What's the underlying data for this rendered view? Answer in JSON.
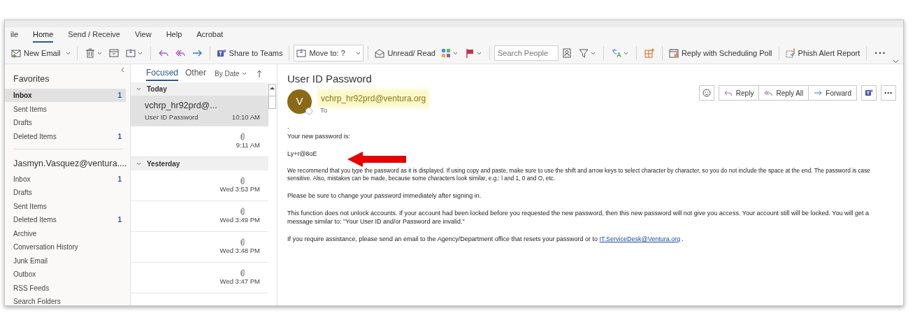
{
  "ribbon_tabs": [
    {
      "label": "ile",
      "selected": false
    },
    {
      "label": "Home",
      "selected": true
    },
    {
      "label": "Send / Receive",
      "selected": false
    },
    {
      "label": "View",
      "selected": false
    },
    {
      "label": "Help",
      "selected": false
    },
    {
      "label": "Acrobat",
      "selected": false
    }
  ],
  "toolbar": [
    {
      "kind": "button",
      "label": "New Email",
      "caret": true
    },
    {
      "kind": "divider"
    },
    {
      "kind": "icon",
      "caret": true
    },
    {
      "kind": "icon",
      "caret": false
    },
    {
      "kind": "icon",
      "caret": true
    },
    {
      "kind": "divider"
    },
    {
      "kind": "icon",
      "caret": false
    },
    {
      "kind": "icon",
      "caret": false
    },
    {
      "kind": "icon",
      "caret": false
    },
    {
      "kind": "divider"
    },
    {
      "kind": "button",
      "label": "Share to Teams",
      "caret": false
    },
    {
      "kind": "divider"
    },
    {
      "kind": "dropdown",
      "label": "Move to: ?"
    },
    {
      "kind": "divider"
    },
    {
      "kind": "button",
      "label": "Unread/ Read",
      "caret": false
    },
    {
      "kind": "icon",
      "caret": true
    },
    {
      "kind": "icon",
      "caret": true
    },
    {
      "kind": "divider"
    },
    {
      "kind": "search",
      "placeholder": "Search People"
    },
    {
      "kind": "icon",
      "caret": false
    },
    {
      "kind": "icon",
      "caret": true
    },
    {
      "kind": "divider"
    },
    {
      "kind": "icon",
      "caret": true
    },
    {
      "kind": "divider"
    },
    {
      "kind": "icon",
      "caret": false
    },
    {
      "kind": "divider"
    },
    {
      "kind": "button",
      "label": "Reply with Scheduling Poll",
      "caret": false
    },
    {
      "kind": "divider"
    },
    {
      "kind": "button",
      "label": "Phish Alert Report",
      "caret": false
    },
    {
      "kind": "divider"
    },
    {
      "kind": "more",
      "label": "···"
    }
  ],
  "folder_pane": {
    "sections": [
      {
        "title": "Favorites",
        "items": [
          {
            "name": "Inbox",
            "count": "1",
            "selected": true
          },
          {
            "name": "Sent Items",
            "selected": false
          },
          {
            "name": "Drafts",
            "selected": false
          },
          {
            "name": "Deleted Items",
            "count": "1",
            "selected": false
          }
        ]
      },
      {
        "title": "Jasmyn.Vasquez@ventura....",
        "items": [
          {
            "name": "Inbox",
            "count": "1",
            "selected": false
          },
          {
            "name": "Drafts",
            "selected": false
          },
          {
            "name": "Sent Items",
            "selected": false
          },
          {
            "name": "Deleted Items",
            "count": "1",
            "selected": false
          },
          {
            "name": "Archive",
            "selected": false
          },
          {
            "name": "Conversation History",
            "selected": false
          },
          {
            "name": "Junk Email",
            "selected": false
          },
          {
            "name": "Outbox",
            "selected": false
          },
          {
            "name": "RSS Feeds",
            "selected": false
          },
          {
            "name": "Search Folders",
            "selected": false
          }
        ]
      }
    ]
  },
  "message_list": {
    "tabs": [
      {
        "label": "Focused",
        "selected": true
      },
      {
        "label": "Other",
        "selected": false
      }
    ],
    "sort": "By Date",
    "groups": [
      {
        "label": "Today",
        "expanded": true,
        "messages": [
          {
            "sender": "vchrp_hr92prd@...",
            "subject": "User ID Password",
            "time": "10:10 AM",
            "attachment": false,
            "selected": true
          },
          {
            "time": "9:11 AM",
            "attachment": true,
            "selected": false
          }
        ]
      },
      {
        "label": "Yesterday",
        "expanded": true,
        "messages": [
          {
            "time": "Wed 3:53 PM",
            "attachment": true,
            "selected": false
          },
          {
            "time": "Wed 3:49 PM",
            "attachment": true,
            "selected": false
          },
          {
            "time": "Wed 3:48 PM",
            "attachment": true,
            "selected": false
          },
          {
            "time": "Wed 3:47 PM",
            "attachment": true,
            "selected": false
          }
        ]
      }
    ]
  },
  "reading_pane": {
    "subject": "User ID Password",
    "avatar": {
      "initial": "V",
      "color": "#8a6a17"
    },
    "from": "vchrp_hr92prd@ventura.org",
    "to_label": "To",
    "actions": [
      {
        "kind": "icon"
      },
      {
        "kind": "button",
        "label": "Reply"
      },
      {
        "kind": "button",
        "label": "Reply All"
      },
      {
        "kind": "button",
        "label": "Forward"
      },
      {
        "kind": "icon"
      },
      {
        "kind": "more",
        "label": "···"
      }
    ],
    "body": [
      {
        "kind": "plain",
        "text": "."
      },
      {
        "kind": "plain",
        "text": "Your new password is:"
      },
      {
        "kind": "password",
        "text": "Ly+r@8oE"
      },
      {
        "kind": "small",
        "text": "We recommend that you type the password as it is displayed.  If using copy and paste, make sure to use the shift and arrow keys to select character by character, so you do not include the space at the end.  The password is case sensitive.  Also, mistakes can be made, because some characters look similar, e.g.:  l  and  1,  0  and  O, etc."
      },
      {
        "kind": "plain",
        "text": "Please be sure to change your password immediately after signing in."
      },
      {
        "kind": "plain",
        "text": "This function does not unlock accounts.  If your account had been locked before you requested the new password, then this new password will not give you access.  Your account still will be locked.  You will get a message similar to: \"Your User ID and/or Password are invalid.\""
      },
      {
        "kind": "link",
        "text": "If you require assistance, please send an email to the Agency/Department office that resets your password or to",
        "link": "IT.ServiceDesk@Ventura.org",
        "after": "."
      }
    ]
  }
}
